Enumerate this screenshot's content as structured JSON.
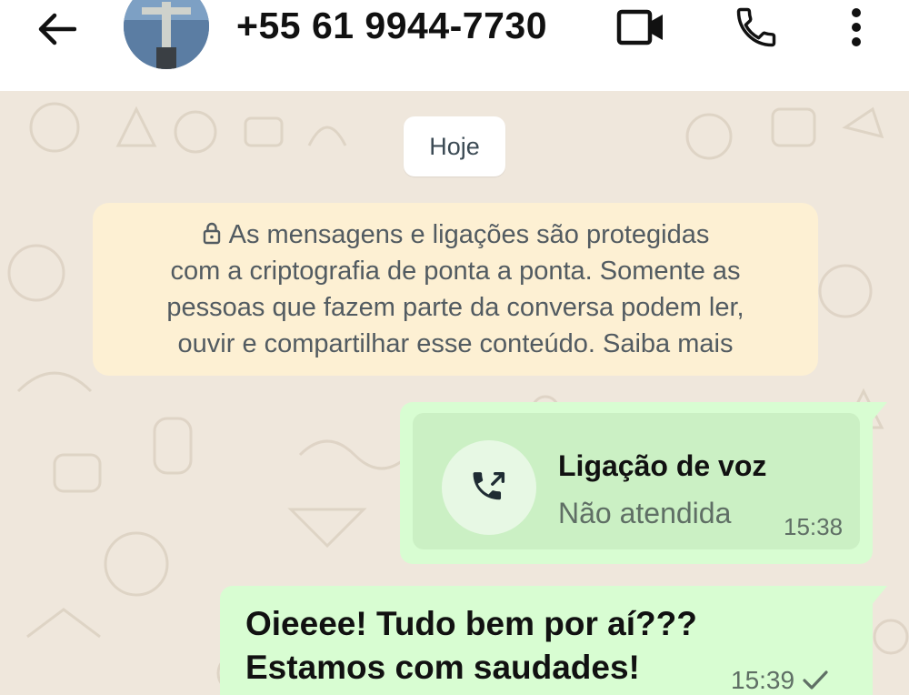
{
  "header": {
    "contact_name": "+55 61 9944-7730",
    "icons": {
      "back": "arrow-left-icon",
      "video": "video-camera-icon",
      "call": "phone-icon",
      "menu": "more-vertical-icon"
    }
  },
  "chat": {
    "date_label": "Hoje",
    "encryption_notice": {
      "lines": [
        "As mensagens e ligações são protegidas",
        "com a criptografia de ponta a ponta. Somente as",
        "pessoas que fazem parte da conversa podem ler,",
        "ouvir e compartilhar esse conteúdo. Saiba mais"
      ],
      "icon": "lock-icon"
    },
    "call_message": {
      "title": "Ligação de voz",
      "status": "Não atendida",
      "time": "15:38",
      "icon": "outgoing-call-icon"
    },
    "text_message": {
      "lines": [
        "Oieeee! Tudo bem por aí???",
        "Estamos com saudades!"
      ],
      "time": "15:39",
      "status_icon": "single-check-icon"
    }
  },
  "colors": {
    "header_bg": "#ffffff",
    "chat_bg": "#efe7dc",
    "outgoing_bubble": "#d8fdd2",
    "notice_bg": "#fdf0d3"
  }
}
